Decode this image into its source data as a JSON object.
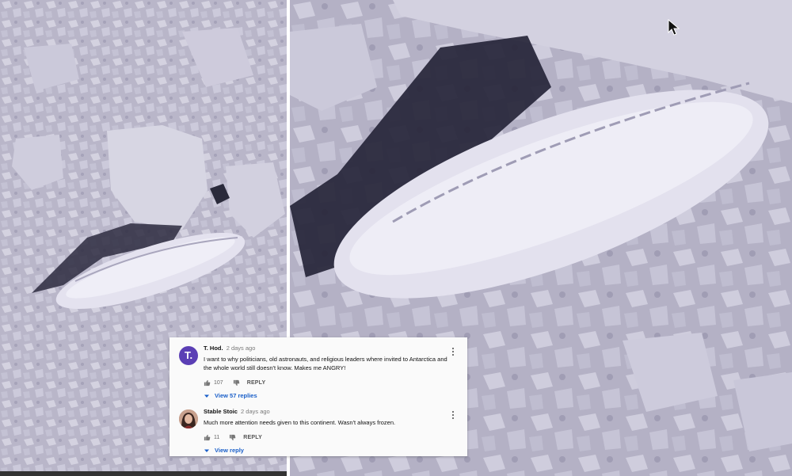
{
  "comments": [
    {
      "author": "T. Hod.",
      "avatar_letter": "T.",
      "avatar_color": "#5b3fb5",
      "time": "2 days ago",
      "text": "I want to why politicians, old astronauts, and religious leaders where invited to Antarctica and the whole world still doesn't know. Makes me ANGRY!",
      "likes": "107",
      "reply_label": "REPLY",
      "view_replies": "View 57 replies"
    },
    {
      "author": "Stable Stoic",
      "time": "2 days ago",
      "text": "Much more attention needs given to this continent. Wasn't always frozen.",
      "likes": "11",
      "reply_label": "REPLY",
      "view_replies": "View reply"
    }
  ],
  "icons": {
    "thumbs_up": "thumbs-up-icon",
    "thumbs_down": "thumbs-down-icon",
    "more": "more-vert-icon",
    "caret": "caret-down-icon",
    "cursor": "mouse-pointer-icon"
  },
  "colors": {
    "link_blue": "#1a5fc9",
    "card_bg": "#fafafa",
    "ice": "#c9c7d8",
    "shadow": "#262538"
  }
}
